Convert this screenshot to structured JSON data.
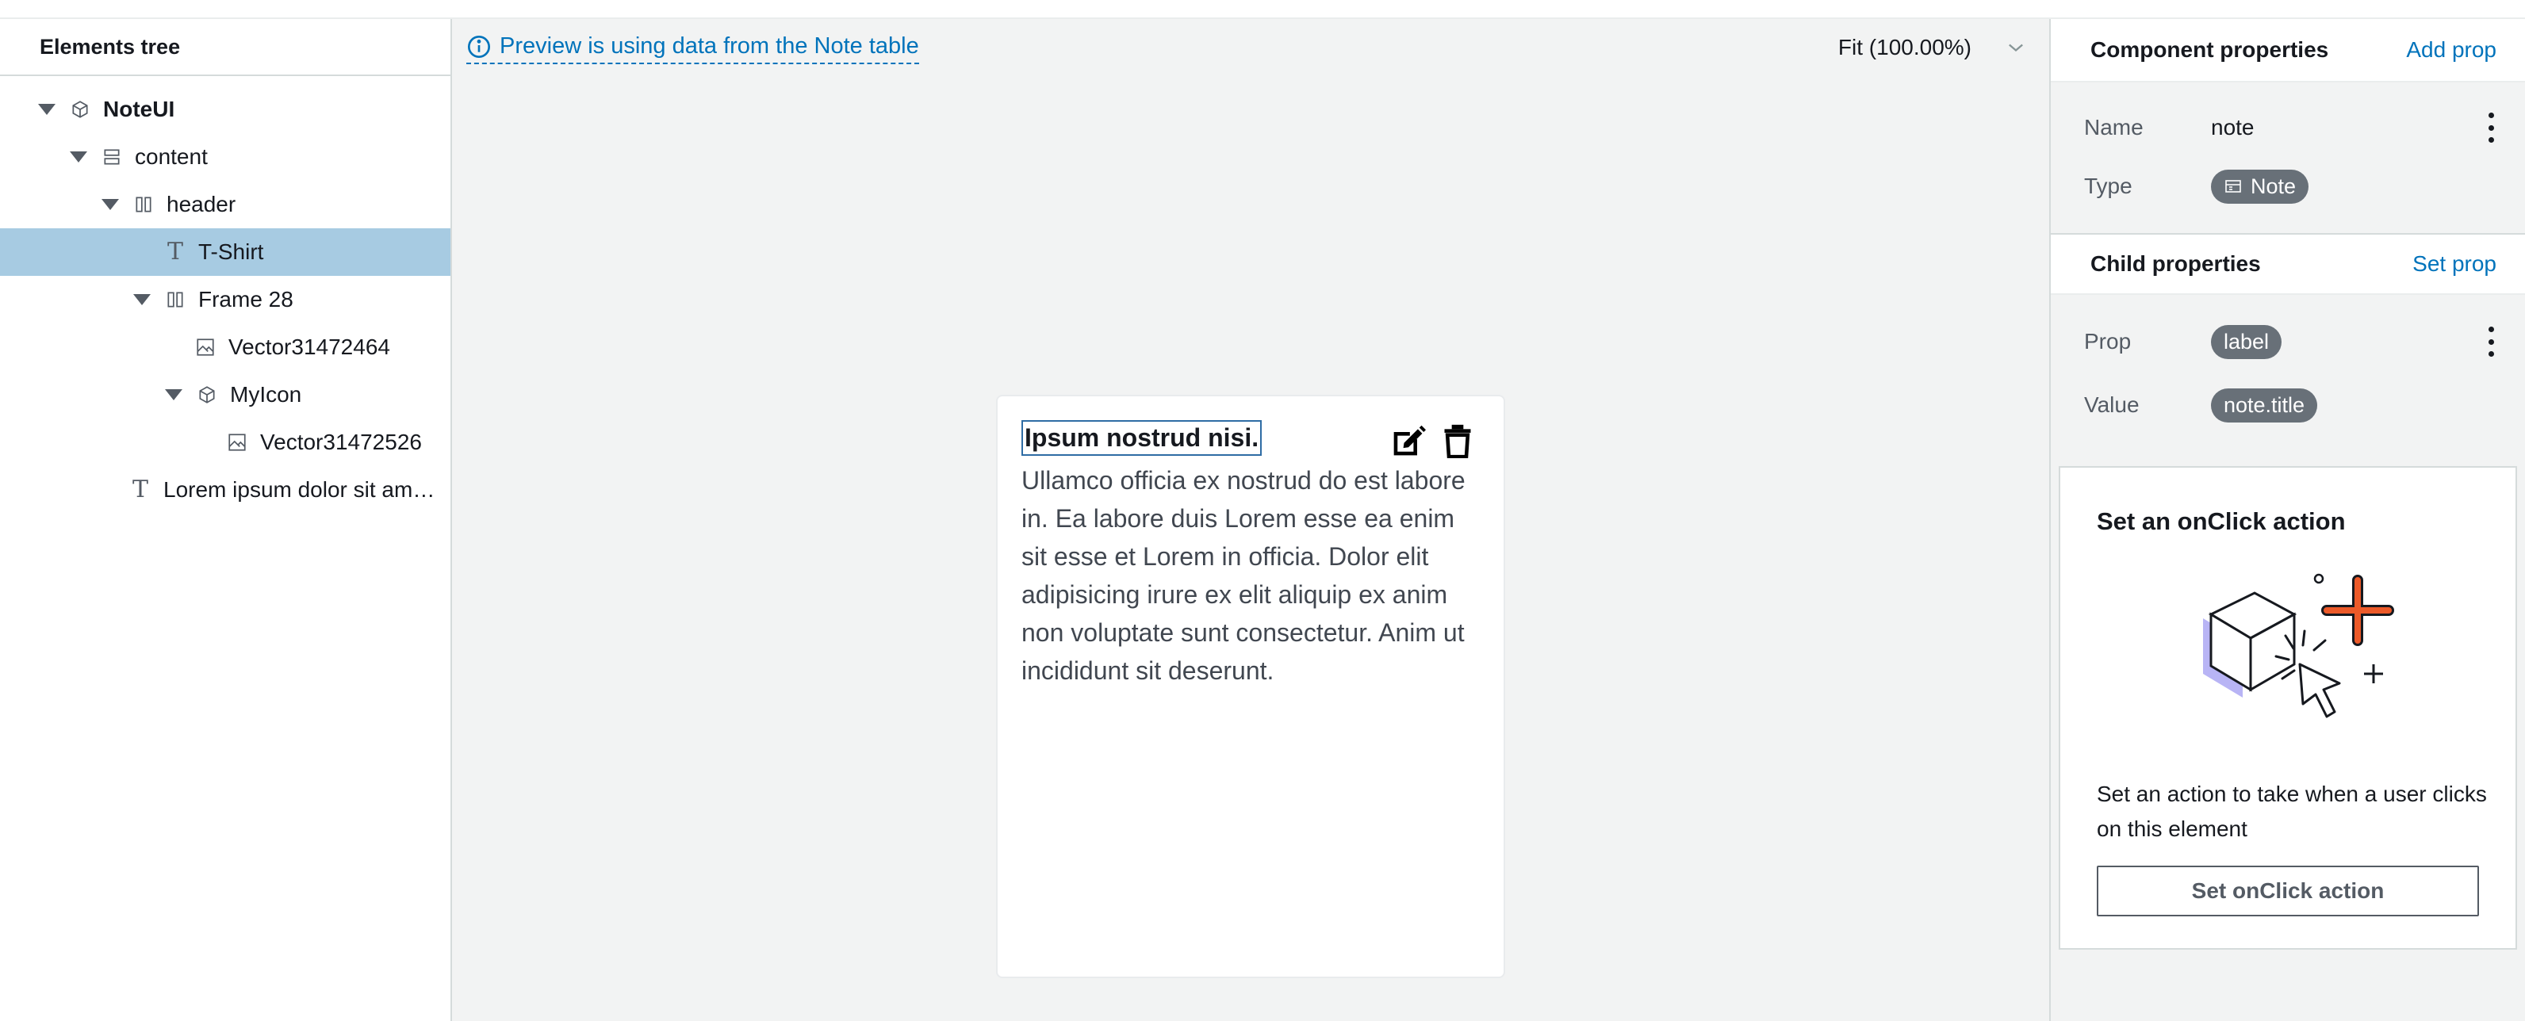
{
  "elements_tree": {
    "title": "Elements tree",
    "nodes": [
      {
        "label": "NoteUI",
        "icon": "component-icon",
        "expanded": true
      },
      {
        "label": "content",
        "icon": "flex-column-icon",
        "expanded": true
      },
      {
        "label": "header",
        "icon": "flex-row-icon",
        "expanded": true
      },
      {
        "label": "T-Shirt",
        "icon": "text-icon",
        "selected": true
      },
      {
        "label": "Frame 28",
        "icon": "flex-row-icon",
        "expanded": true
      },
      {
        "label": "Vector31472464",
        "icon": "image-icon"
      },
      {
        "label": "MyIcon",
        "icon": "component-icon",
        "expanded": true
      },
      {
        "label": "Vector31472526",
        "icon": "image-icon"
      },
      {
        "label": "Lorem ipsum dolor sit am…",
        "icon": "text-icon"
      }
    ]
  },
  "canvas": {
    "preview_notice": "Preview is using data from the Note table",
    "zoom_label": "Fit (100.00%)",
    "card": {
      "title": "Ipsum nostrud nisi.",
      "body": "Ullamco officia ex nostrud do est labore in. Ea labore duis Lorem esse ea enim sit esse et Lorem in officia. Dolor elit adipisicing irure ex elit aliquip ex anim non voluptate sunt consectetur. Anim ut incididunt sit deserunt."
    }
  },
  "properties": {
    "component": {
      "title": "Component properties",
      "action": "Add prop",
      "name_label": "Name",
      "name_value": "note",
      "type_label": "Type",
      "type_value": "Note"
    },
    "child": {
      "title": "Child properties",
      "action": "Set prop",
      "prop_label": "Prop",
      "prop_value": "label",
      "value_label": "Value",
      "value_value": "note.title"
    },
    "onclick": {
      "title": "Set an onClick action",
      "description": "Set an action to take when a user clicks on this element",
      "button": "Set onClick action"
    }
  },
  "colors": {
    "link": "#0073bb",
    "selected_row": "#a7cbe2",
    "pill": "#687078",
    "accent_plus": "#ec5a29",
    "illus_shadow": "#b8b4f5"
  }
}
